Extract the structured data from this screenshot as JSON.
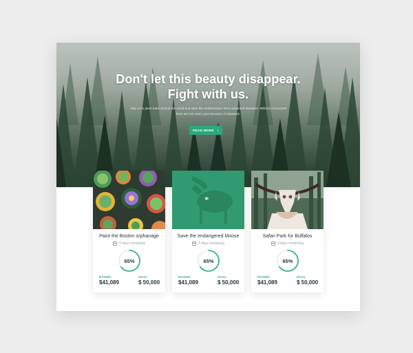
{
  "hero": {
    "title_line1": "Don't let this beauty disappear.",
    "title_line2": "Fight with us.",
    "subtitle": "Help us to plant trees around the world and save the mothernature from unwanted disasters. Millions of innocent lives are lost every year because of disasters.",
    "button_label": "READ MORE",
    "button_icon": "chevron-right-icon"
  },
  "colors": {
    "accent": "#2aa87e",
    "text_dark": "#2b3340",
    "muted": "#9aa2ab"
  },
  "cards": [
    {
      "title": "Paint the Boston orphanage",
      "days": "3 days remaining",
      "percent": 65,
      "percent_label": "65%",
      "raised_label": "RAISED",
      "raised": "$41,089",
      "goal_label": "GOAL",
      "goal": "$ 50,000"
    },
    {
      "title": "Save the endangered Moose",
      "days": "3 days remaining",
      "percent": 65,
      "percent_label": "65%",
      "raised_label": "RAISED",
      "raised": "$41,089",
      "goal_label": "GOAL",
      "goal": "$ 50,000"
    },
    {
      "title": "Safari Park for Buffalos",
      "days": "3 days remaining",
      "percent": 65,
      "percent_label": "65%",
      "raised_label": "RAISED",
      "raised": "$41,089",
      "goal_label": "GOAL",
      "goal": "$ 50,000"
    }
  ]
}
